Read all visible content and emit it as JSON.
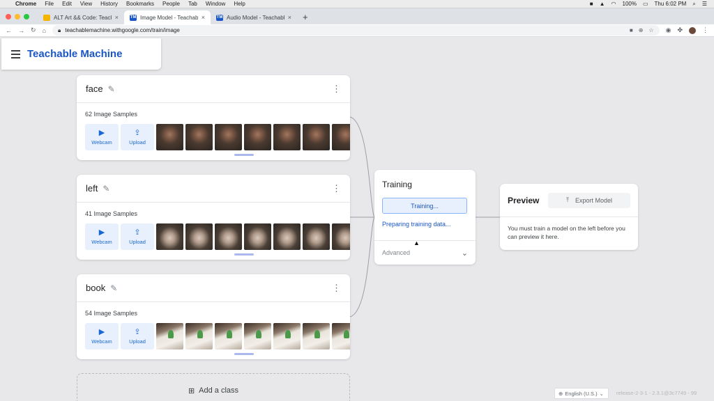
{
  "menubar": {
    "apple": "",
    "app": "Chrome",
    "items": [
      "File",
      "Edit",
      "View",
      "History",
      "Bookmarks",
      "People",
      "Tab",
      "Window",
      "Help"
    ],
    "battery": "100%",
    "clock": "Thu 6:02 PM"
  },
  "tabs": [
    {
      "title": "ALT Art && Code: Teachable M",
      "favicon": "doc-icon",
      "color": "#f4b400"
    },
    {
      "title": "Image Model - Teachable Mach",
      "favicon": "tm-icon",
      "color": "#1a56c4"
    },
    {
      "title": "Audio Model - Teachable Mach",
      "favicon": "tm-icon",
      "color": "#1a56c4"
    }
  ],
  "address": {
    "url": "teachablemachine.withgoogle.com/train/image"
  },
  "app": {
    "logo": "Teachable Machine",
    "brand_color": "#1a56c4"
  },
  "classes": [
    {
      "name": "face",
      "samples": "62 Image Samples",
      "webcam": "Webcam",
      "upload": "Upload"
    },
    {
      "name": "left",
      "samples": "41 Image Samples",
      "webcam": "Webcam",
      "upload": "Upload"
    },
    {
      "name": "book",
      "samples": "54 Image Samples",
      "webcam": "Webcam",
      "upload": "Upload"
    }
  ],
  "add_class": "Add a class",
  "training": {
    "title": "Training",
    "button": "Training...",
    "status": "Preparing training data...",
    "advanced": "Advanced"
  },
  "preview": {
    "title": "Preview",
    "export": "Export Model",
    "message": "You must train a model on the left before you can preview it here."
  },
  "footer": {
    "language": "English (U.S.)",
    "release": "release-2-3-1 - 2.3.1@3c7749 - 99"
  }
}
